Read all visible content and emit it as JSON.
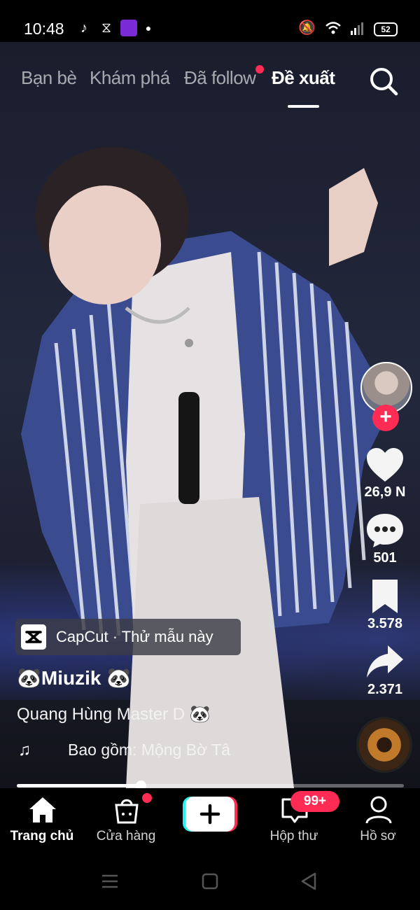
{
  "status_bar": {
    "time": "10:48",
    "battery": "52",
    "icons": [
      "tiktok-icon",
      "capcut-icon",
      "app-icon",
      "dot-icon",
      "mute-icon",
      "wifi-icon",
      "signal-icon",
      "battery-icon"
    ]
  },
  "top_tabs": {
    "items": [
      {
        "label": "Bạn bè"
      },
      {
        "label": "Khám phá"
      },
      {
        "label": "Đã follow"
      },
      {
        "label": "Đề xuất"
      }
    ],
    "active_index": 3
  },
  "right_rail": {
    "likes": "26,9 N",
    "comments": "501",
    "saves": "3.578",
    "shares": "2.371"
  },
  "video": {
    "capcut_label": "CapCut · Thử mẫu này",
    "author": "🐼Miuzik 🐼",
    "description": "Quang Hùng Master D 🐼",
    "music": "Bao gồm: Mộng Bờ Tâ",
    "progress": 0.32
  },
  "bottom_nav": {
    "items": [
      {
        "label": "Trang chủ",
        "icon": "home-icon"
      },
      {
        "label": "Cửa hàng",
        "icon": "shopping-bag-icon"
      },
      {
        "label": "",
        "icon": "plus-icon"
      },
      {
        "label": "Hộp thư",
        "icon": "inbox-icon"
      },
      {
        "label": "Hồ sơ",
        "icon": "profile-icon"
      }
    ],
    "inbox_badge": "99+"
  },
  "colors": {
    "accent": "#fe2c55",
    "create_cyan": "#25f4ee",
    "background": "#000000"
  }
}
